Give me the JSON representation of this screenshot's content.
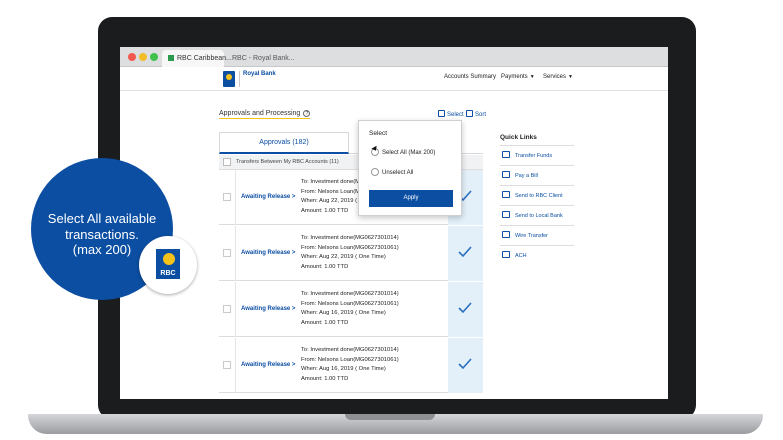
{
  "browser": {
    "tabs": [
      {
        "label": "RBC Caribbean..."
      },
      {
        "label": "RBC - Royal Bank..."
      }
    ]
  },
  "header": {
    "bank_name": "Royal Bank",
    "nav": {
      "accounts_summary": "Accounts Summary",
      "payments": "Payments",
      "services": "Services"
    }
  },
  "page": {
    "title": "Approvals and Processing",
    "select_label": "Select",
    "sort_label": "Sort"
  },
  "table": {
    "tab_label": "Approvals (182)",
    "group_header": "Transfers Between My RBC Accounts (11)",
    "rows": [
      {
        "status": "Awaiting Release >",
        "to": "To: Investment done(MG0627301014)",
        "from": "From: Nelsons Loan(MG0627301061)",
        "when": "When: Aug 22, 2019 ( One Time)",
        "amount": "Amount: 1.00 TTD"
      },
      {
        "status": "Awaiting Release >",
        "to": "To: Investment done(MG0627301014)",
        "from": "From: Nelsons Loan(MG0627301061)",
        "when": "When: Aug 22, 2019 ( One Time)",
        "amount": "Amount: 1.00 TTD"
      },
      {
        "status": "Awaiting Release >",
        "to": "To: Investment done(MG0627301014)",
        "from": "From: Nelsons Loan(MG0627301061)",
        "when": "When: Aug 16, 2019 ( One Time)",
        "amount": "Amount: 1.00 TTD"
      },
      {
        "status": "Awaiting Release >",
        "to": "To: Investment done(MG0627301014)",
        "from": "From: Nelsons Loan(MG0627301061)",
        "when": "When: Aug 16, 2019 ( One Time)",
        "amount": "Amount: 1.00 TTD"
      }
    ]
  },
  "popup": {
    "title": "Select",
    "option_select_all": "Select All (Max 200)",
    "option_unselect_all": "Unselect All",
    "apply_label": "Apply"
  },
  "quick_links": {
    "title": "Quick Links",
    "items": [
      {
        "label": "Transfer Funds"
      },
      {
        "label": "Pay a Bill"
      },
      {
        "label": "Send to RBC Client"
      },
      {
        "label": "Send to Local Bank"
      },
      {
        "label": "Wire Transfer"
      },
      {
        "label": "ACH"
      }
    ]
  },
  "callout": {
    "line1": "Select All available",
    "line2": "transactions.",
    "line3": "(max 200)",
    "badge_text": "RBC"
  },
  "colors": {
    "brand_blue": "#0b4ea2",
    "brand_yellow": "#f5c21b",
    "selected_column": "#e3f0fa"
  }
}
